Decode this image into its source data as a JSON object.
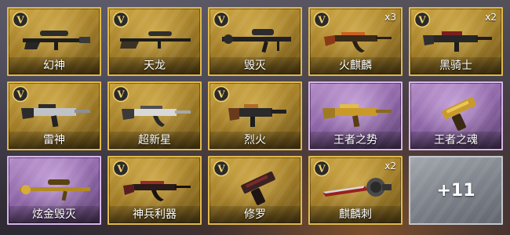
{
  "theme": {
    "gold_border": "#e0b94a",
    "purple_border": "#d7b6ea",
    "grey_border": "#c3c7cd"
  },
  "cards": [
    {
      "name": "幻神",
      "rarity": "gold",
      "badge": "V",
      "count": "",
      "icon": "sniper-rifle-icon"
    },
    {
      "name": "天龙",
      "rarity": "gold",
      "badge": "V",
      "count": "",
      "icon": "sniper-rifle-icon"
    },
    {
      "name": "毁灭",
      "rarity": "gold",
      "badge": "V",
      "count": "",
      "icon": "heavy-sniper-icon"
    },
    {
      "name": "火麒麟",
      "rarity": "gold",
      "badge": "V",
      "count": "x3",
      "icon": "assault-rifle-icon"
    },
    {
      "name": "黑骑士",
      "rarity": "gold",
      "badge": "V",
      "count": "x2",
      "icon": "assault-rifle-icon"
    },
    {
      "name": "雷神",
      "rarity": "gold",
      "badge": "V",
      "count": "",
      "icon": "assault-rifle-icon"
    },
    {
      "name": "超新星",
      "rarity": "gold",
      "badge": "V",
      "count": "",
      "icon": "assault-rifle-icon"
    },
    {
      "name": "烈火",
      "rarity": "gold",
      "badge": "V",
      "count": "",
      "icon": "carbine-icon"
    },
    {
      "name": "王者之势",
      "rarity": "purple",
      "badge": "",
      "count": "",
      "icon": "golden-rifle-icon"
    },
    {
      "name": "王者之魂",
      "rarity": "purple",
      "badge": "",
      "count": "",
      "icon": "golden-pistol-icon"
    },
    {
      "name": "炫金毁灭",
      "rarity": "purple",
      "badge": "",
      "count": "",
      "icon": "golden-sniper-icon"
    },
    {
      "name": "神兵利器",
      "rarity": "gold",
      "badge": "V",
      "count": "",
      "icon": "assault-rifle-icon"
    },
    {
      "name": "修罗",
      "rarity": "gold",
      "badge": "V",
      "count": "",
      "icon": "pistol-icon"
    },
    {
      "name": "麒麟刺",
      "rarity": "gold",
      "badge": "V",
      "count": "x2",
      "icon": "knife-icon"
    }
  ],
  "more": {
    "label": "+11"
  }
}
